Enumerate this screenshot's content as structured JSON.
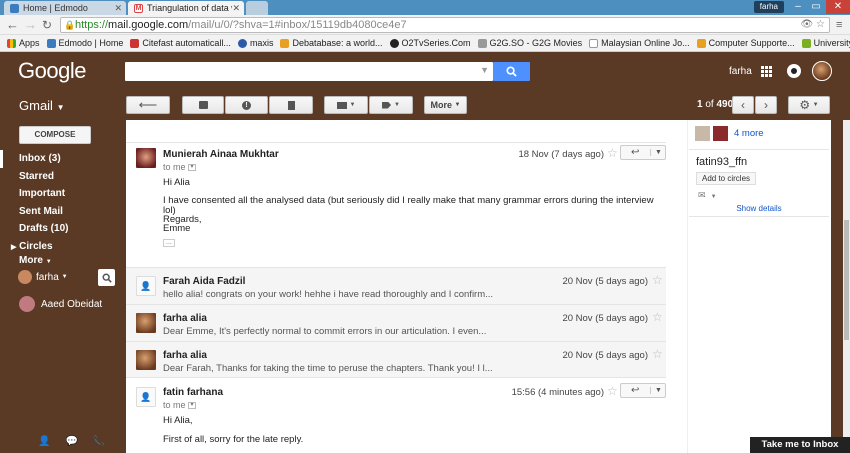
{
  "browser": {
    "tabs": [
      {
        "title": "Home | Edmodo"
      },
      {
        "title": "Triangulation of data with"
      }
    ],
    "window_user": "farha",
    "url_scheme": "https://",
    "url_host": "mail.google.com",
    "url_path": "/mail/u/0/?shva=1#inbox/15119db4080ce4e7",
    "bookmarks": [
      "Apps",
      "Edmodo | Home",
      "Citefast automaticall...",
      "maxis",
      "Debatabase: a world...",
      "O2TvSeries.Com",
      "G2G.SO - G2G Movies",
      "Malaysian Online Jo...",
      "Computer Supporte...",
      "University of Birmin..."
    ],
    "other_bookmarks": "»"
  },
  "header": {
    "logo": "Google",
    "user_label": "farha",
    "app_label": "Gmail"
  },
  "toolbar": {
    "page_current": "1",
    "page_total": "490",
    "more_label": "More"
  },
  "compose_label": "COMPOSE",
  "nav": [
    {
      "label": "Inbox (3)"
    },
    {
      "label": "Starred"
    },
    {
      "label": "Important"
    },
    {
      "label": "Sent Mail"
    },
    {
      "label": "Drafts (10)"
    },
    {
      "label": "Circles"
    },
    {
      "label": "More"
    }
  ],
  "chat": {
    "self": "farha",
    "contact": "Aaed Obeidat"
  },
  "messages": [
    {
      "sender": "Munierah Ainaa Mukhtar",
      "date": "18 Nov (7 days ago)",
      "to": "to me",
      "greeting": "Hi Alia",
      "body": "I have consented all the analysed data (but seriously did I really make that many grammar errors during the interview lol)",
      "sign1": "Regards,",
      "sign2": "Emme",
      "dots": "..."
    },
    {
      "sender": "Farah Aida Fadzil",
      "date": "20 Nov (5 days ago)",
      "snippet": "hello alia! congrats on your work! hehhe i have read thoroughly and I confirm..."
    },
    {
      "sender": "farha alia",
      "date": "20 Nov (5 days ago)",
      "snippet": "Dear Emme, It's perfectly normal to commit errors in our articulation. I even..."
    },
    {
      "sender": "farha alia",
      "date": "20 Nov (5 days ago)",
      "snippet": "Dear Farah, Thanks for taking the time to peruse the chapters. Thank you! I l..."
    },
    {
      "sender": "fatin farhana",
      "date": "15:56 (4 minutes ago)",
      "to": "to me",
      "greeting": "Hi Alia,",
      "body": "First of all, sorry for the late reply."
    }
  ],
  "people": {
    "more": "4 more",
    "name": "fatin93_ffn",
    "add_circles": "Add to circles",
    "details": "Show details"
  },
  "take_me": "Take me to Inbox"
}
